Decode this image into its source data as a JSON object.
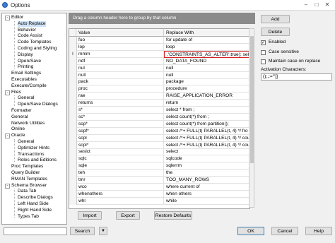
{
  "window": {
    "title": "Options"
  },
  "tree": {
    "items": [
      {
        "label": "Editor",
        "expanded": true
      },
      {
        "label": "Auto Replace",
        "selected": true
      },
      {
        "label": "Behavior"
      },
      {
        "label": "Code Assist"
      },
      {
        "label": "Code Templates"
      },
      {
        "label": "Coding and Styling"
      },
      {
        "label": "Display"
      },
      {
        "label": "Open/Save"
      },
      {
        "label": "Printing"
      },
      {
        "label": "Email Settings"
      },
      {
        "label": "Executables"
      },
      {
        "label": "Execute/Compile"
      },
      {
        "label": "Files",
        "expanded": true
      },
      {
        "label": "General"
      },
      {
        "label": "Open/Save Dialogs"
      },
      {
        "label": "Formatter"
      },
      {
        "label": "General"
      },
      {
        "label": "Network Utilities"
      },
      {
        "label": "Online"
      },
      {
        "label": "Oracle",
        "expanded": true
      },
      {
        "label": "General"
      },
      {
        "label": "Optimizer Hints"
      },
      {
        "label": "Transactions"
      },
      {
        "label": "Roles and Editions"
      },
      {
        "label": "Proc Templates"
      },
      {
        "label": "Query Builder"
      },
      {
        "label": "RMAN Templates"
      },
      {
        "label": "Schema Browser",
        "expanded": true
      },
      {
        "label": "Data Tab"
      },
      {
        "label": "Describe Dialogs"
      },
      {
        "label": "Left Hand Side"
      },
      {
        "label": "Right Hand Side"
      },
      {
        "label": "Types Tab"
      }
    ]
  },
  "grid": {
    "group_hint": "Drag a column header here to group by that column",
    "columns": [
      "Value",
      "Replace With"
    ],
    "rows": [
      {
        "value": "fuo",
        "replace": "for update of"
      },
      {
        "value": "lop",
        "replace": "loop"
      },
      {
        "value": "mmm",
        "replace": ",'CONSTRAINTS_AS_ALTER',true); select db",
        "editing": true
      },
      {
        "value": "ndf",
        "replace": "NO_DATA_FOUND"
      },
      {
        "value": "nul",
        "replace": "null"
      },
      {
        "value": "null",
        "replace": "null"
      },
      {
        "value": "pack",
        "replace": "package"
      },
      {
        "value": "proc",
        "replace": "procedure"
      },
      {
        "value": "rae",
        "replace": "RAISE_APPLICATION_ERROR"
      },
      {
        "value": "returns",
        "replace": "return"
      },
      {
        "value": "s*",
        "replace": "select * from ;"
      },
      {
        "value": "sc*",
        "replace": "select count(*) from ;"
      },
      {
        "value": "scp*",
        "replace": "select count(*) from partition();"
      },
      {
        "value": "scpf*",
        "replace": "select /*+ FULL(t) PARALLEL(t, 4) */ fro"
      },
      {
        "value": "scpl",
        "replace": "select /*+ FULL(t) PARALLEL(t, 4) */ cou"
      },
      {
        "value": "scpl*",
        "replace": "select /*+ FULL(t) PARALLEL(t, 4) */ cou"
      },
      {
        "value": "seslct",
        "replace": "select"
      },
      {
        "value": "sqlc",
        "replace": "sqlcode"
      },
      {
        "value": "sqle",
        "replace": "sqlerrm"
      },
      {
        "value": "teh",
        "replace": "the"
      },
      {
        "value": "tmr",
        "replace": "TOO_MANY_ROWS"
      },
      {
        "value": "wco",
        "replace": "where current of"
      },
      {
        "value": "whenothers",
        "replace": "when others"
      },
      {
        "value": "whl",
        "replace": "while"
      }
    ]
  },
  "buttons": {
    "add": "Add",
    "delete": "Delete",
    "import": "Import",
    "export": "Export",
    "restore": "Restore Defaults",
    "search": "Search",
    "ok": "OK",
    "cancel": "Cancel",
    "help": "Help"
  },
  "options": {
    "enabled_label": "Enabled",
    "enabled": true,
    "case_sensitive_label": "Case sensitive",
    "case_sensitive": false,
    "maintain_case_label": "Maintain case on replace",
    "maintain_case": false,
    "activation_label": "Activation Characters:",
    "activation_value": "();,:=\"'[]"
  },
  "search": {
    "value": ""
  },
  "colors": {
    "group_bar": "#8b8b8b",
    "selection": "#cfe3f7",
    "edit_border": "#d42020"
  }
}
